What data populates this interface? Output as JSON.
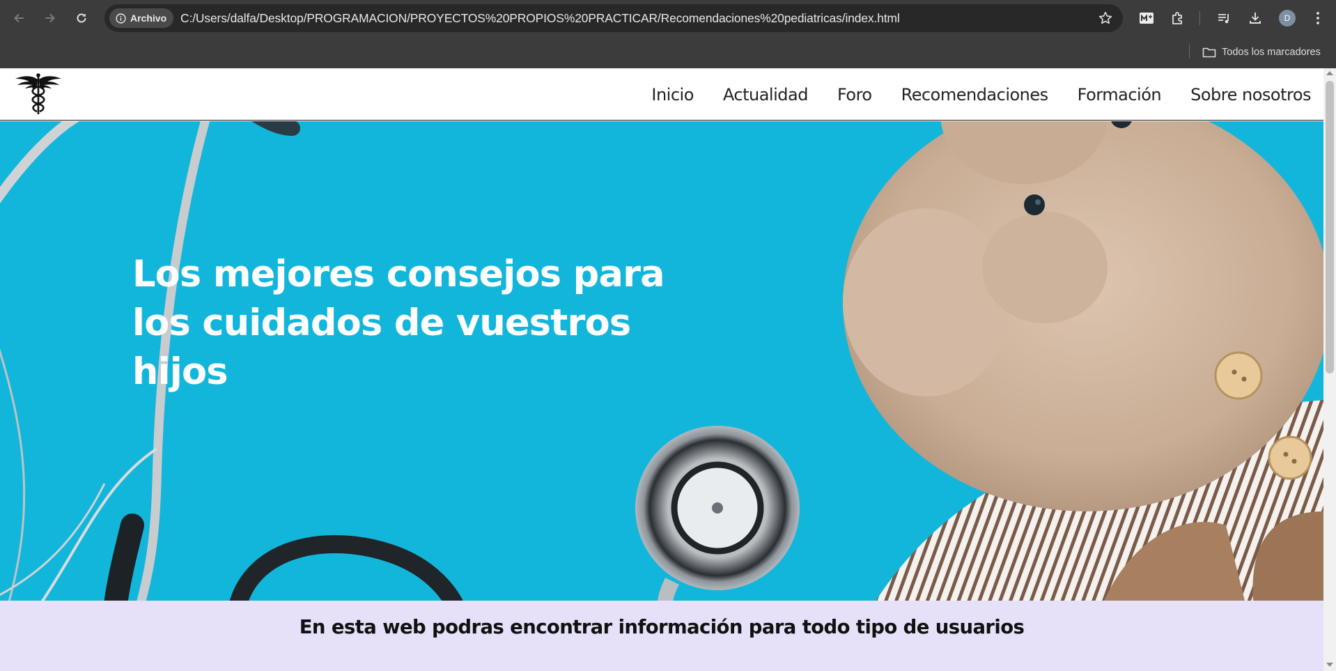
{
  "browser": {
    "address_chip": "Archivo",
    "url": "C:/Users/dalfa/Desktop/PROGRAMACION/PROYECTOS%20PROPIOS%20PRACTICAR/Recomendaciones%20pediatricas/index.html",
    "profile_initial": "D",
    "bookmarks_all_label": "Todos los marcadores",
    "icons": [
      "back-arrow-icon",
      "forward-arrow-icon",
      "reload-icon",
      "info-icon",
      "star-icon",
      "extension-m-icon",
      "puzzle-icon",
      "media-queue-icon",
      "download-icon",
      "kebab-menu-icon",
      "folder-icon"
    ]
  },
  "site": {
    "logo_icon": "caduceus-icon",
    "nav": [
      {
        "label": "Inicio"
      },
      {
        "label": "Actualidad"
      },
      {
        "label": "Foro"
      },
      {
        "label": "Recomendaciones"
      },
      {
        "label": "Formación"
      },
      {
        "label": "Sobre nosotros"
      }
    ],
    "hero": {
      "title": "Los mejores consejos para los cuidados de vuestros hijos",
      "background_color": "#13b6db"
    },
    "band": {
      "text": "En esta web podras encontrar información para todo tipo de usuarios",
      "background_color": "#e6e1f8"
    }
  }
}
